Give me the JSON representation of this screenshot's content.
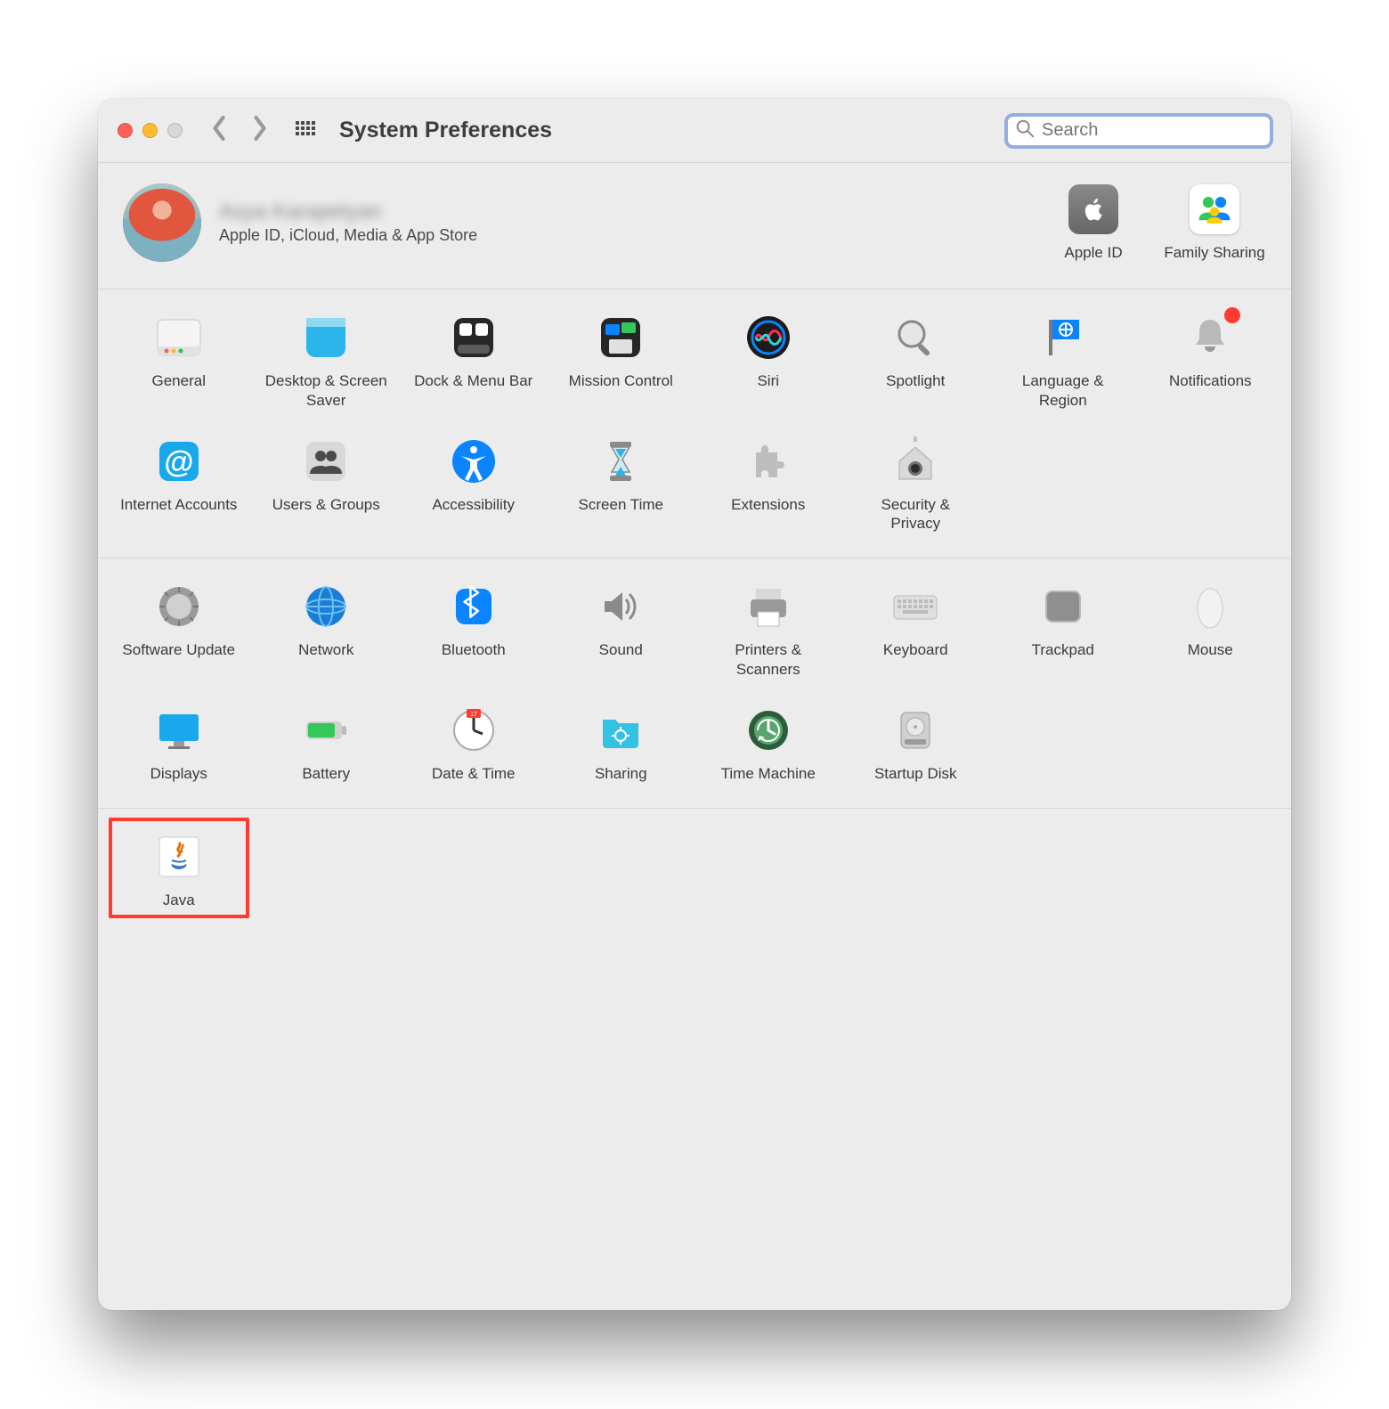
{
  "window": {
    "title": "System Preferences"
  },
  "search": {
    "placeholder": "Search",
    "value": ""
  },
  "account": {
    "name": "Asya Karapetyan",
    "subtitle": "Apple ID, iCloud, Media & App Store",
    "right": [
      {
        "id": "apple-id",
        "label": "Apple ID"
      },
      {
        "id": "family-sharing",
        "label": "Family Sharing"
      }
    ]
  },
  "sections": [
    {
      "rows": [
        [
          {
            "id": "general",
            "label": "General"
          },
          {
            "id": "desktop-screensaver",
            "label": "Desktop & Screen Saver"
          },
          {
            "id": "dock-menubar",
            "label": "Dock & Menu Bar"
          },
          {
            "id": "mission-control",
            "label": "Mission Control"
          },
          {
            "id": "siri",
            "label": "Siri"
          },
          {
            "id": "spotlight",
            "label": "Spotlight"
          },
          {
            "id": "language-region",
            "label": "Language & Region"
          },
          {
            "id": "notifications",
            "label": "Notifications"
          }
        ],
        [
          {
            "id": "internet-accounts",
            "label": "Internet Accounts"
          },
          {
            "id": "users-groups",
            "label": "Users & Groups"
          },
          {
            "id": "accessibility",
            "label": "Accessibility"
          },
          {
            "id": "screen-time",
            "label": "Screen Time"
          },
          {
            "id": "extensions",
            "label": "Extensions"
          },
          {
            "id": "security-privacy",
            "label": "Security & Privacy"
          }
        ]
      ]
    },
    {
      "rows": [
        [
          {
            "id": "software-update",
            "label": "Software Update"
          },
          {
            "id": "network",
            "label": "Network"
          },
          {
            "id": "bluetooth",
            "label": "Bluetooth"
          },
          {
            "id": "sound",
            "label": "Sound"
          },
          {
            "id": "printers-scanners",
            "label": "Printers & Scanners"
          },
          {
            "id": "keyboard",
            "label": "Keyboard"
          },
          {
            "id": "trackpad",
            "label": "Trackpad"
          },
          {
            "id": "mouse",
            "label": "Mouse"
          }
        ],
        [
          {
            "id": "displays",
            "label": "Displays"
          },
          {
            "id": "battery",
            "label": "Battery"
          },
          {
            "id": "date-time",
            "label": "Date & Time"
          },
          {
            "id": "sharing",
            "label": "Sharing"
          },
          {
            "id": "time-machine",
            "label": "Time Machine"
          },
          {
            "id": "startup-disk",
            "label": "Startup Disk"
          }
        ]
      ]
    },
    {
      "rows": [
        [
          {
            "id": "java",
            "label": "Java",
            "highlight": true
          }
        ]
      ]
    }
  ],
  "icons": {
    "apple-id": "apple-logo-icon",
    "family-sharing": "family-icon",
    "general": "general-icon",
    "desktop-screensaver": "desktop-icon",
    "dock-menubar": "dock-icon",
    "mission-control": "mission-control-icon",
    "siri": "siri-icon",
    "spotlight": "magnifier-icon",
    "language-region": "flag-icon",
    "notifications": "bell-icon",
    "internet-accounts": "at-sign-icon",
    "users-groups": "users-icon",
    "accessibility": "accessibility-icon",
    "screen-time": "hourglass-icon",
    "extensions": "puzzle-icon",
    "security-privacy": "house-lock-icon",
    "software-update": "gear-icon",
    "network": "globe-icon",
    "bluetooth": "bluetooth-icon",
    "sound": "speaker-icon",
    "printers-scanners": "printer-icon",
    "keyboard": "keyboard-icon",
    "trackpad": "trackpad-icon",
    "mouse": "mouse-icon",
    "displays": "display-icon",
    "battery": "battery-icon",
    "date-time": "clock-icon",
    "sharing": "folder-icon",
    "time-machine": "time-machine-icon",
    "startup-disk": "disk-icon",
    "java": "java-icon"
  }
}
